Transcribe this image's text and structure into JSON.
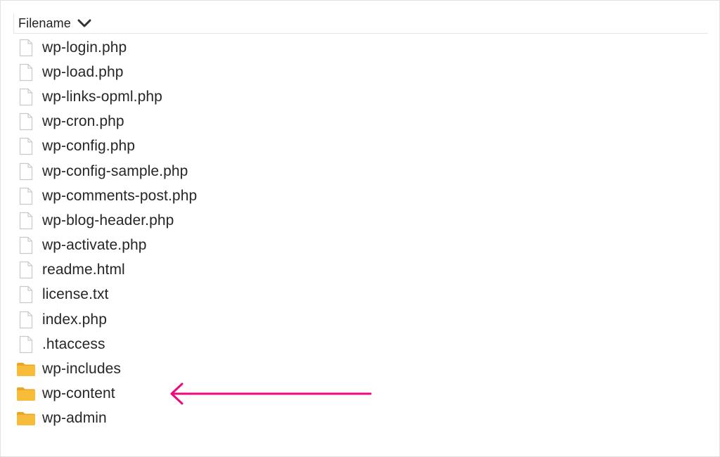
{
  "column_header": {
    "label": "Filename",
    "sort_icon": "chevron-down-icon"
  },
  "files": [
    {
      "name": "wp-login.php",
      "type": "file",
      "icon": "file-icon"
    },
    {
      "name": "wp-load.php",
      "type": "file",
      "icon": "file-icon"
    },
    {
      "name": "wp-links-opml.php",
      "type": "file",
      "icon": "file-icon"
    },
    {
      "name": "wp-cron.php",
      "type": "file",
      "icon": "file-icon"
    },
    {
      "name": "wp-config.php",
      "type": "file",
      "icon": "file-icon"
    },
    {
      "name": "wp-config-sample.php",
      "type": "file",
      "icon": "file-icon"
    },
    {
      "name": "wp-comments-post.php",
      "type": "file",
      "icon": "file-icon"
    },
    {
      "name": "wp-blog-header.php",
      "type": "file",
      "icon": "file-icon"
    },
    {
      "name": "wp-activate.php",
      "type": "file",
      "icon": "file-icon"
    },
    {
      "name": "readme.html",
      "type": "file",
      "icon": "file-icon"
    },
    {
      "name": "license.txt",
      "type": "file",
      "icon": "file-icon"
    },
    {
      "name": "index.php",
      "type": "file",
      "icon": "file-icon"
    },
    {
      "name": ".htaccess",
      "type": "file",
      "icon": "file-icon"
    },
    {
      "name": "wp-includes",
      "type": "folder",
      "icon": "folder-icon"
    },
    {
      "name": "wp-content",
      "type": "folder",
      "icon": "folder-icon"
    },
    {
      "name": "wp-admin",
      "type": "folder",
      "icon": "folder-icon"
    }
  ],
  "annotation": {
    "icon": "arrow-left-icon",
    "points_to": "wp-content",
    "color": "#ee0a7d"
  },
  "colors": {
    "folder": "#f7bd3a",
    "folder_tab": "#eba623",
    "file_outline": "#c9c9c9"
  }
}
